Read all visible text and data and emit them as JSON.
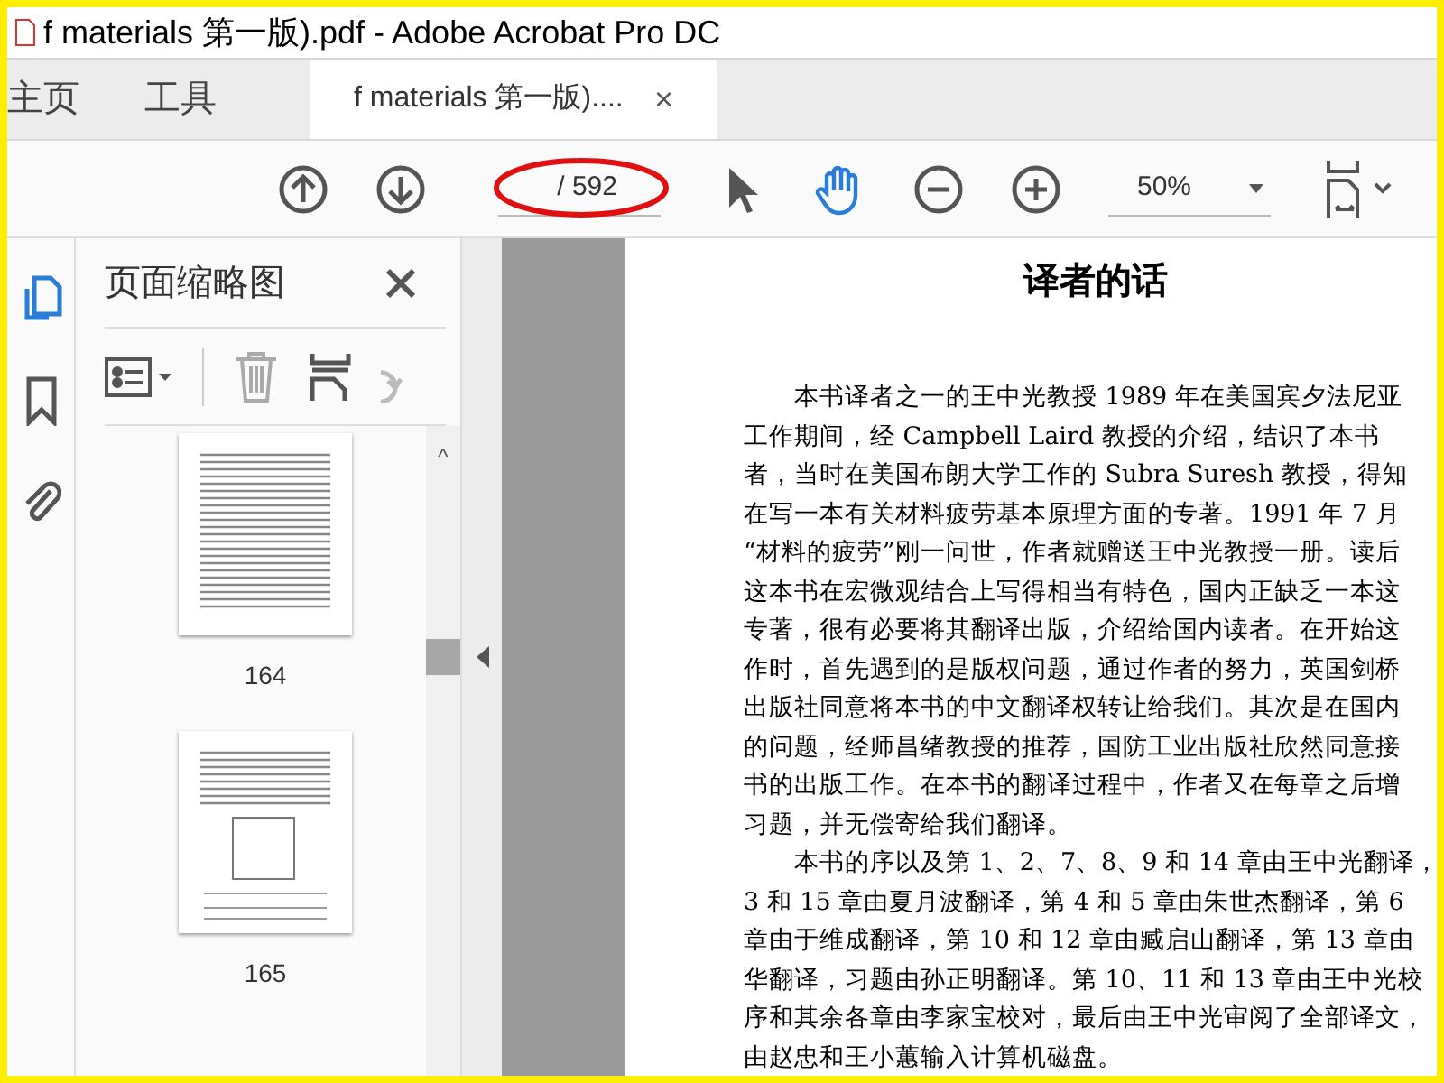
{
  "window": {
    "title": "f materials 第一版).pdf - Adobe Acrobat Pro DC"
  },
  "tabs": [
    {
      "label": "主页",
      "kind": "nav",
      "selected": false
    },
    {
      "label": "工具",
      "kind": "nav",
      "selected": false
    },
    {
      "label": "f materials 第一版)....",
      "kind": "doc",
      "selected": true,
      "close": "×"
    }
  ],
  "toolbar": {
    "page_total": "/ 592",
    "zoom": "50%",
    "hand_tool_selected": true
  },
  "sidebar": {
    "title": "页面缩略图",
    "thumbnails": [
      {
        "label": "164",
        "kind": "text"
      },
      {
        "label": "165",
        "kind": "figure"
      }
    ],
    "scroll_up": "^"
  },
  "document": {
    "heading": "译者的话",
    "lines": [
      {
        "text": "本书译者之一的王中光教授 1989 年在美国宾夕法尼亚",
        "kind": "first"
      },
      {
        "text": "工作期间，经 Campbell Laird 教授的介绍，结识了本书",
        "kind": "line"
      },
      {
        "text": "者，当时在美国布朗大学工作的 Subra Suresh 教授，得知",
        "kind": "line"
      },
      {
        "text": "在写一本有关材料疲劳基本原理方面的专著。1991 年 7 月",
        "kind": "line"
      },
      {
        "text": "“材料的疲劳”刚一问世，作者就赠送王中光教授一册。读后",
        "kind": "line"
      },
      {
        "text": "这本书在宏微观结合上写得相当有特色，国内正缺乏一本这",
        "kind": "line"
      },
      {
        "text": "专著，很有必要将其翻译出版，介绍给国内读者。在开始这",
        "kind": "line"
      },
      {
        "text": "作时，首先遇到的是版权问题，通过作者的努力，英国剑桥",
        "kind": "line"
      },
      {
        "text": "出版社同意将本书的中文翻译权转让给我们。其次是在国内",
        "kind": "line"
      },
      {
        "text": "的问题，经师昌绪教授的推荐，国防工业出版社欣然同意接",
        "kind": "line"
      },
      {
        "text": "书的出版工作。在本书的翻译过程中，作者又在每章之后增",
        "kind": "line"
      },
      {
        "text": "习题，并无偿寄给我们翻译。",
        "kind": "line"
      },
      {
        "text": "本书的序以及第 1、2、7、8、9 和 14 章由王中光翻译，",
        "kind": "first"
      },
      {
        "text": "3 和 15 章由夏月波翻译，第 4 和 5 章由朱世杰翻译，第 6",
        "kind": "line"
      },
      {
        "text": "章由于维成翻译，第 10 和 12 章由臧启山翻译，第 13 章由",
        "kind": "line"
      },
      {
        "text": "华翻译，习题由孙正明翻译。第 10、11 和 13 章由王中光校",
        "kind": "line"
      },
      {
        "text": "序和其余各章由李家宝校对，最后由王中光审阅了全部译文，",
        "kind": "line"
      },
      {
        "text": "由赵忠和王小蕙输入计算机磁盘。",
        "kind": "line"
      }
    ]
  }
}
